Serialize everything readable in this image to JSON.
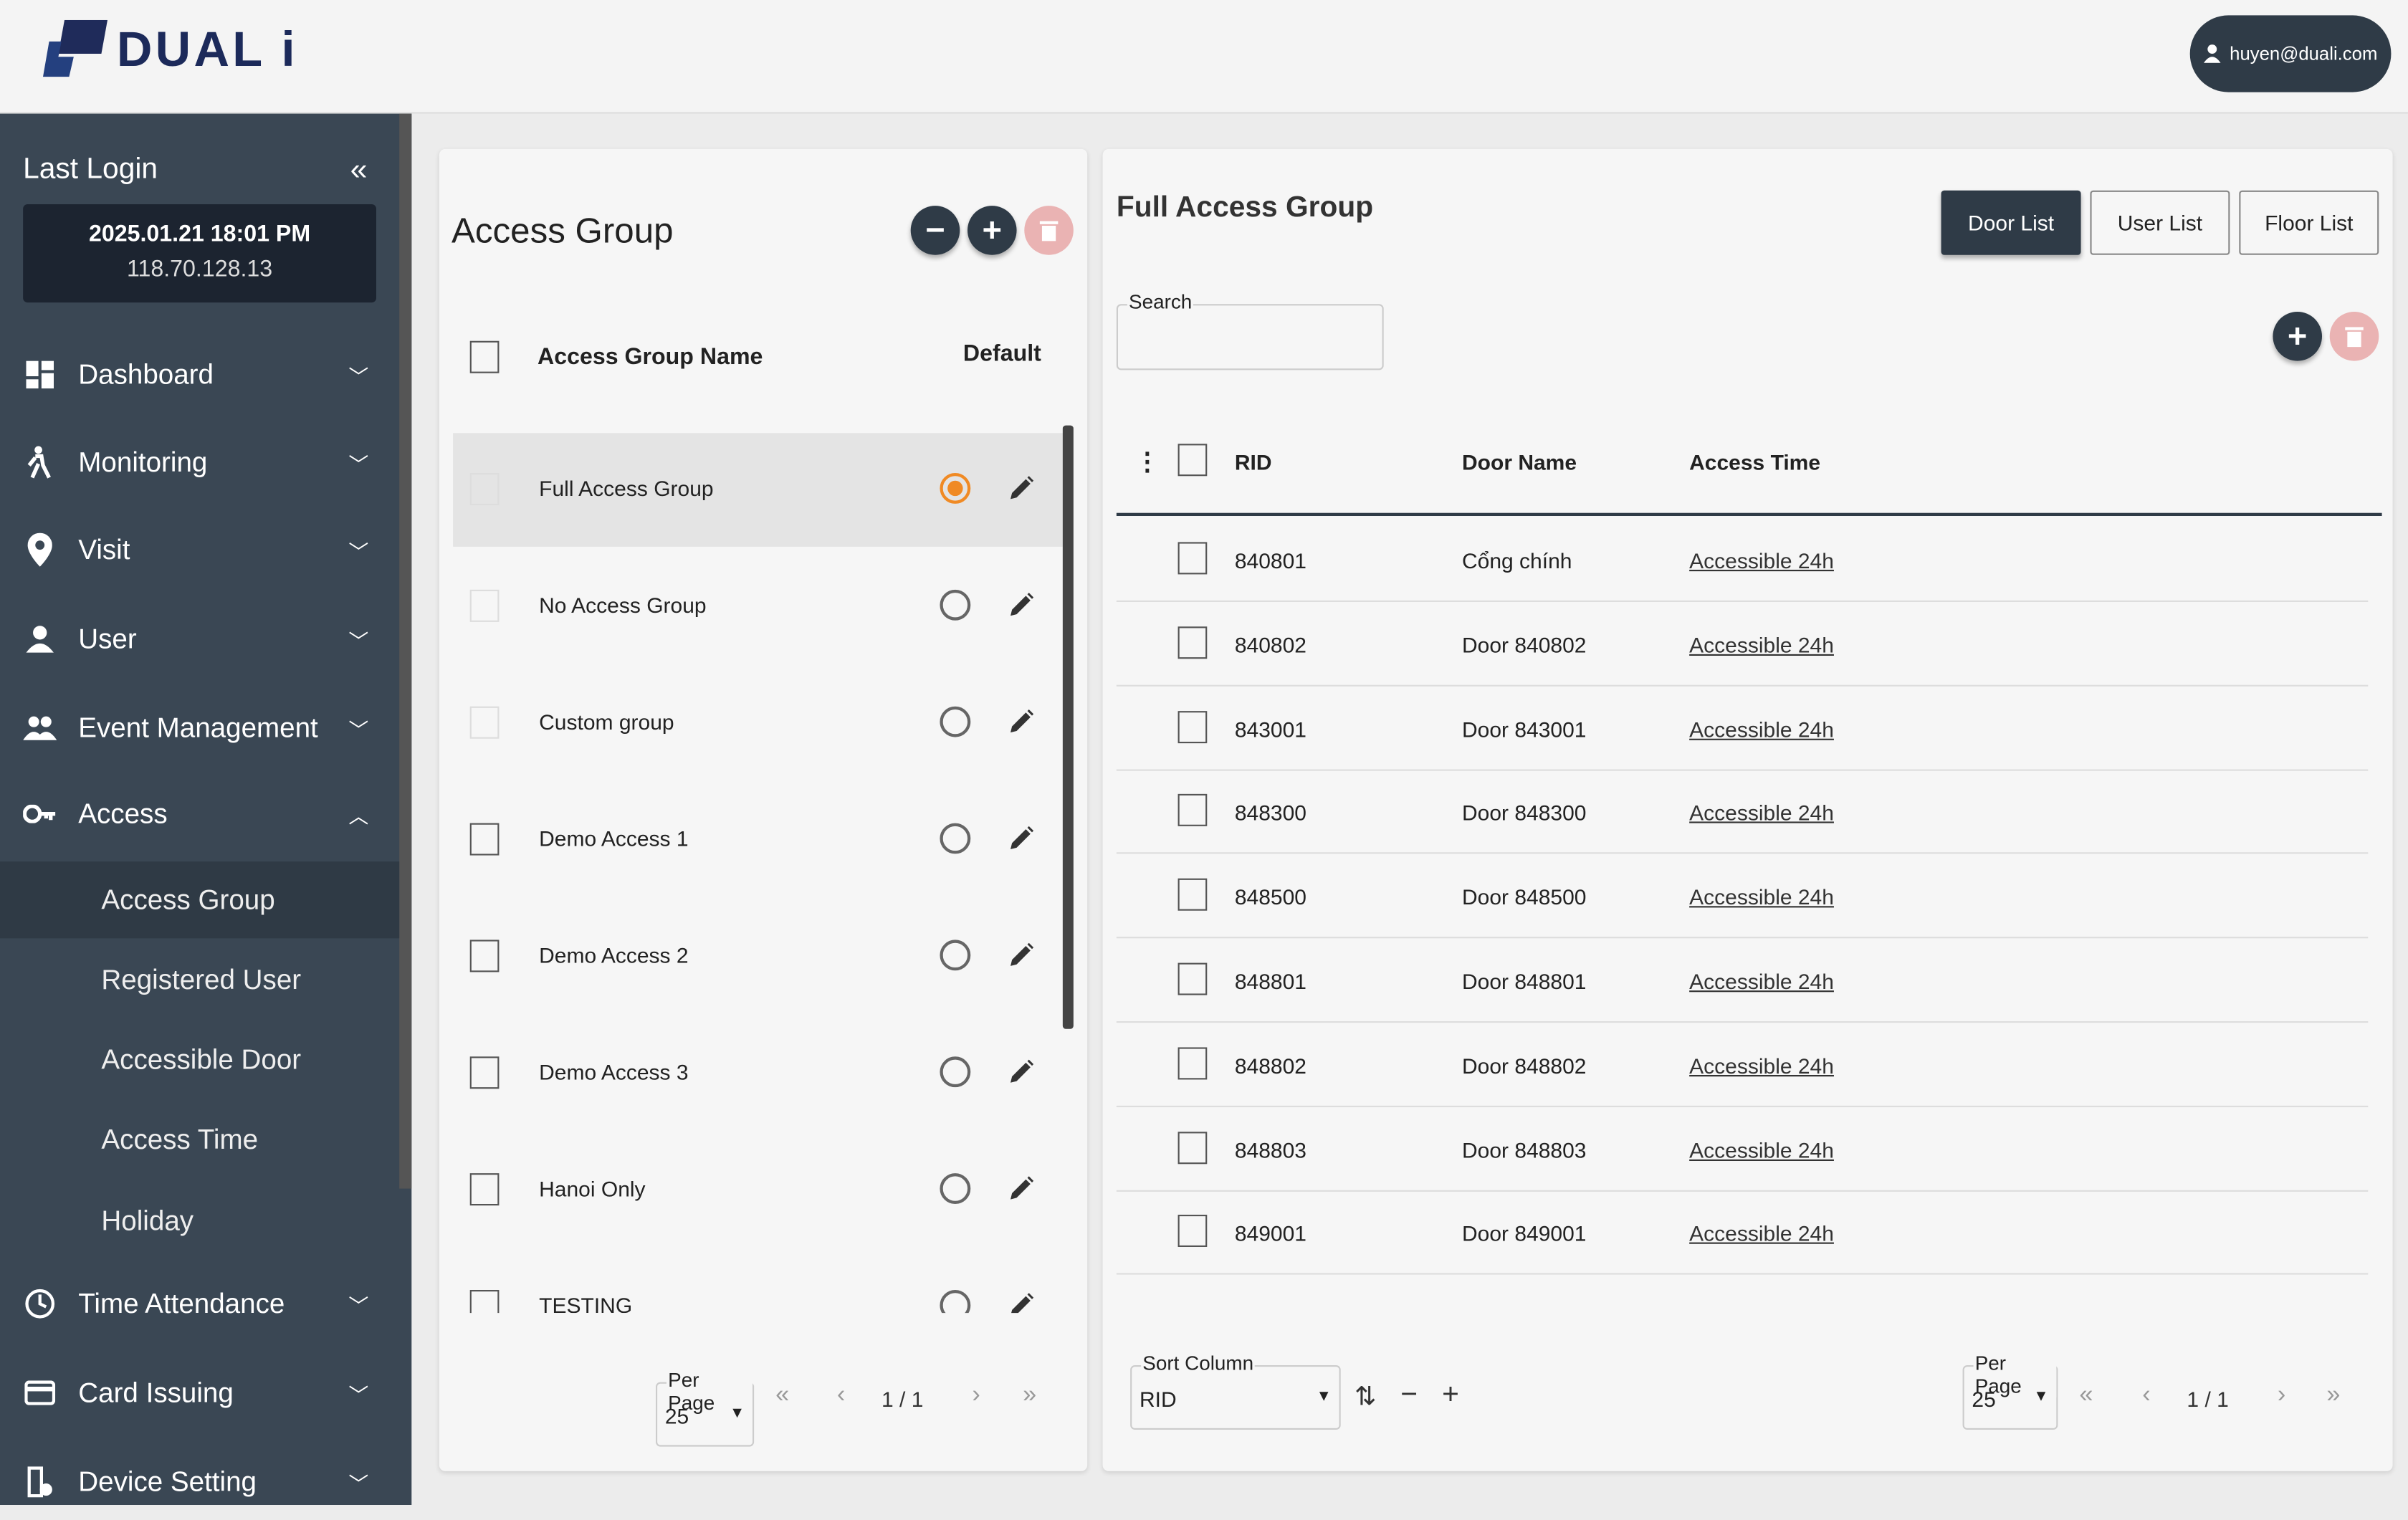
{
  "brand": {
    "logo_text": "DUAL i"
  },
  "user": {
    "email": "huyen@duali.com"
  },
  "sidebar": {
    "last_login_label": "Last Login",
    "last_login_datetime": "2025.01.21 18:01 PM",
    "last_login_ip": "118.70.128.13",
    "items": [
      {
        "label": "Dashboard",
        "icon": "dashboard-icon"
      },
      {
        "label": "Monitoring",
        "icon": "walking-person-icon"
      },
      {
        "label": "Visit",
        "icon": "map-pin-icon"
      },
      {
        "label": "User",
        "icon": "user-icon"
      },
      {
        "label": "Event Management",
        "icon": "users-icon"
      },
      {
        "label": "Access",
        "icon": "key-icon",
        "expanded": true
      },
      {
        "label": "Time Attendance",
        "icon": "clock-icon"
      },
      {
        "label": "Card Issuing",
        "icon": "card-icon"
      },
      {
        "label": "Device Setting",
        "icon": "device-icon"
      }
    ],
    "access_subitems": [
      {
        "label": "Access Group",
        "active": true
      },
      {
        "label": "Registered User"
      },
      {
        "label": "Accessible Door"
      },
      {
        "label": "Access Time"
      },
      {
        "label": "Holiday"
      }
    ]
  },
  "access_group_panel": {
    "title": "Access Group",
    "col_name": "Access Group Name",
    "col_default": "Default",
    "rows": [
      {
        "name": "Full Access Group",
        "default": true,
        "selected": true
      },
      {
        "name": "No Access Group",
        "default": false
      },
      {
        "name": "Custom group",
        "default": false
      },
      {
        "name": "Demo Access 1",
        "default": false
      },
      {
        "name": "Demo Access 2",
        "default": false
      },
      {
        "name": "Demo Access 3",
        "default": false
      },
      {
        "name": "Hanoi Only",
        "default": false
      },
      {
        "name": "TESTING",
        "default": false
      }
    ],
    "per_page_label": "Per Page",
    "per_page": "25",
    "page": "1 / 1"
  },
  "detail_panel": {
    "title": "Full Access Group",
    "tabs": [
      "Door List",
      "User List",
      "Floor List"
    ],
    "active_tab": "Door List",
    "search_label": "Search",
    "search_value": "",
    "columns": [
      "RID",
      "Door Name",
      "Access Time"
    ],
    "rows": [
      {
        "rid": "840801",
        "door": "Cổng chính",
        "time": "Accessible 24h"
      },
      {
        "rid": "840802",
        "door": "Door 840802",
        "time": "Accessible 24h"
      },
      {
        "rid": "843001",
        "door": "Door 843001",
        "time": "Accessible 24h"
      },
      {
        "rid": "848300",
        "door": "Door 848300",
        "time": "Accessible 24h"
      },
      {
        "rid": "848500",
        "door": "Door 848500",
        "time": "Accessible 24h"
      },
      {
        "rid": "848801",
        "door": "Door 848801",
        "time": "Accessible 24h"
      },
      {
        "rid": "848802",
        "door": "Door 848802",
        "time": "Accessible 24h"
      },
      {
        "rid": "848803",
        "door": "Door 848803",
        "time": "Accessible 24h"
      },
      {
        "rid": "849001",
        "door": "Door 849001",
        "time": "Accessible 24h"
      }
    ],
    "sort_label": "Sort Column",
    "sort_value": "RID",
    "per_page_label": "Per Page",
    "per_page": "25",
    "page": "1 / 1"
  },
  "colors": {
    "accent_dark": "#2f3b47",
    "sidebar": "#3a4754",
    "radio_selected": "#f08a24",
    "delete_disabled": "#eab3b3"
  }
}
